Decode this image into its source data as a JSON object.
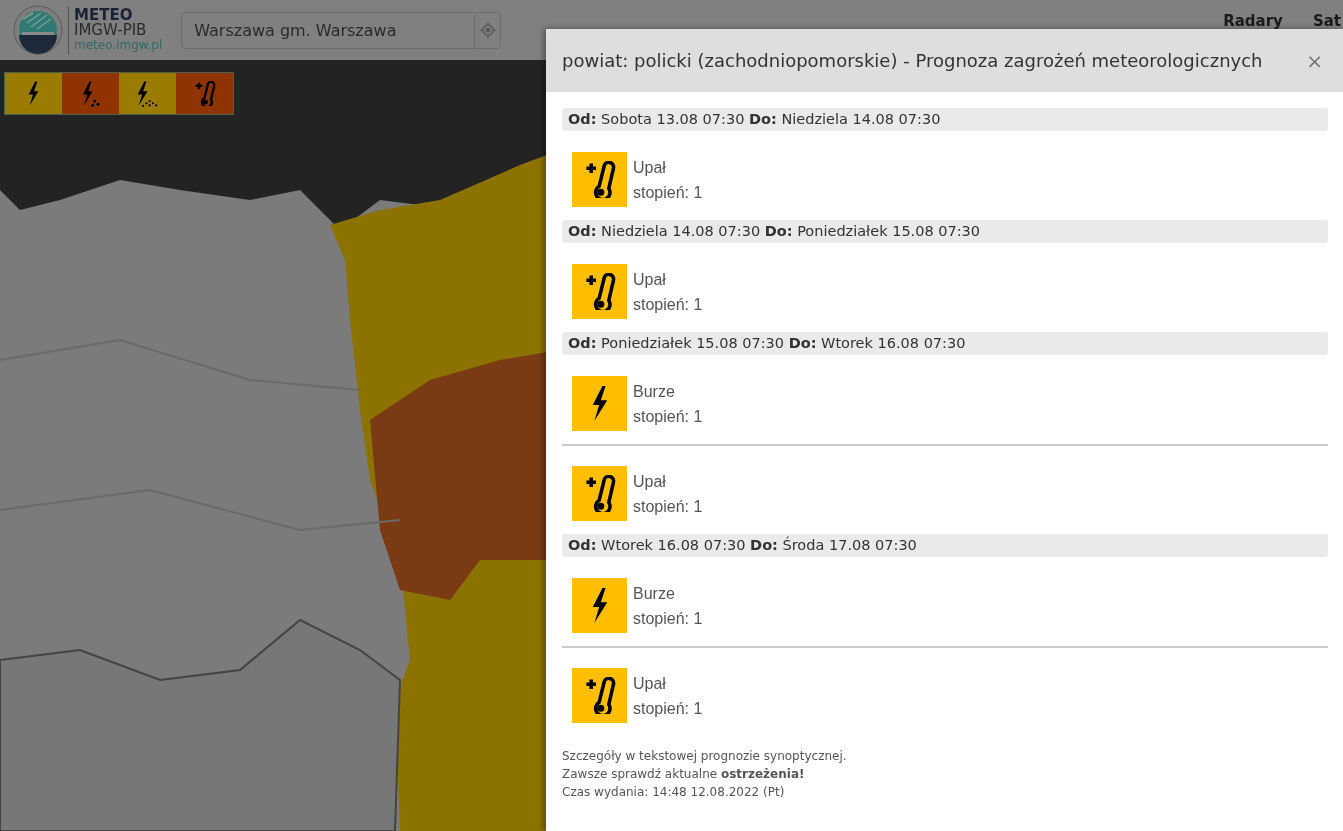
{
  "header": {
    "brand": {
      "title": "METEO",
      "subtitle": "IMGW-PIB",
      "url": "meteo.imgw.pl"
    },
    "search": {
      "value": "Warszawa gm. Warszawa"
    },
    "nav": [
      "Radary",
      "Sat"
    ]
  },
  "legend": [
    {
      "kind": "storm",
      "color": "#9a7c00"
    },
    {
      "kind": "storm_hail",
      "color": "#8f3400"
    },
    {
      "kind": "storm_rain",
      "color": "#9a7c00"
    },
    {
      "kind": "heat",
      "color": "#8f3400"
    }
  ],
  "modal": {
    "title": "powiat: policki (zachodniopomorskie) - Prognoza zagrożeń meteorologicznych",
    "close": "×",
    "periods": [
      {
        "range": "**Od:** Sobota 13.08 07:30 **Do:** Niedziela 14.08 07:30",
        "warnings": [
          {
            "kind": "heat",
            "name": "Upał",
            "level": "stopień: 1"
          }
        ]
      },
      {
        "range": "**Od:** Niedziela 14.08 07:30 **Do:** Poniedziałek 15.08 07:30",
        "warnings": [
          {
            "kind": "heat",
            "name": "Upał",
            "level": "stopień: 1"
          }
        ]
      },
      {
        "range": "**Od:** Poniedziałek 15.08 07:30 **Do:** Wtorek 16.08 07:30",
        "warnings": [
          {
            "kind": "storm",
            "name": "Burze",
            "level": "stopień: 1"
          },
          {
            "kind": "heat",
            "name": "Upał",
            "level": "stopień: 1"
          }
        ]
      },
      {
        "range": "**Od:** Wtorek 16.08 07:30 **Do:** Środa 17.08 07:30",
        "warnings": [
          {
            "kind": "storm",
            "name": "Burze",
            "level": "stopień: 1"
          },
          {
            "kind": "heat",
            "name": "Upał",
            "level": "stopień: 1"
          }
        ]
      }
    ],
    "footer": [
      "Szczegóły w tekstowej prognozie synoptycznej.",
      "Zawsze sprawdź aktualne **ostrzeżenia!**",
      "Czas wydania: 14:48 12.08.2022 (Pt)"
    ]
  }
}
